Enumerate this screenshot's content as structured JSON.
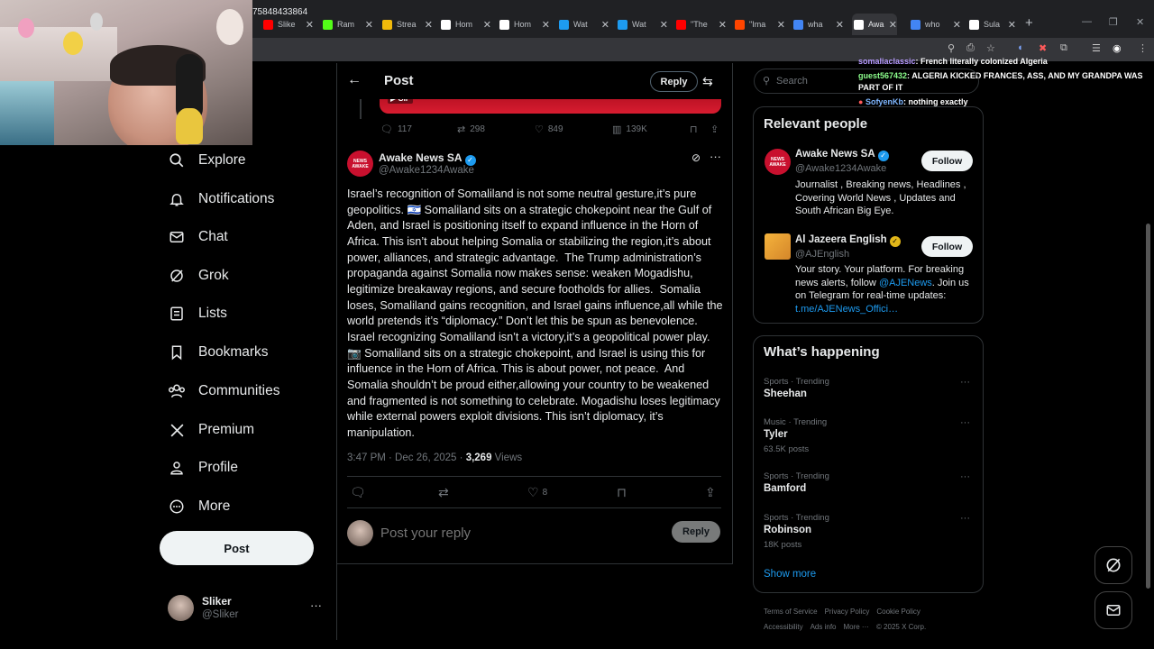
{
  "browser": {
    "tabs": [
      {
        "label": "Slike",
        "color": "#ff0000"
      },
      {
        "label": "Ram",
        "color": "#53fc18"
      },
      {
        "label": "Strea",
        "color": "#f0b90b"
      },
      {
        "label": "Hom",
        "color": "#ffffff"
      },
      {
        "label": "Hom",
        "color": "#ffffff"
      },
      {
        "label": "Wat",
        "color": "#1d9bf0"
      },
      {
        "label": "Wat",
        "color": "#1d9bf0"
      },
      {
        "label": "\"The",
        "color": "#ff0000"
      },
      {
        "label": "\"Ima",
        "color": "#ff4500"
      },
      {
        "label": "wha",
        "color": "#4285f4"
      },
      {
        "label": "Awa",
        "color": "#ffffff"
      },
      {
        "label": "who",
        "color": "#4285f4"
      },
      {
        "label": "Sula",
        "color": "#ffffff"
      }
    ],
    "active_tab": 10,
    "url": "75848433864"
  },
  "chat": [
    {
      "user": "somaliaclassic",
      "text": ": French literally colonized Algeria",
      "userColor": "#b79bff"
    },
    {
      "user": "guest567432",
      "text": ": ALGERIA KICKED FRANCES, ASS, AND MY GRANDPA WAS PART OF IT",
      "userColor": "#8dff8d"
    },
    {
      "user": "SofyenKb",
      "text": ": nothing exactly",
      "userColor": "#7fb6ff"
    }
  ],
  "nav": {
    "items": [
      "Explore",
      "Notifications",
      "Chat",
      "Grok",
      "Lists",
      "Bookmarks",
      "Communities",
      "Premium",
      "Profile",
      "More"
    ],
    "post_label": "Post",
    "user_name": "Sliker",
    "user_handle": "@Sliker"
  },
  "main": {
    "title": "Post",
    "reply_label": "Reply",
    "gif_label": "GIF",
    "quoted_stats": {
      "replies": "117",
      "reposts": "298",
      "likes": "849",
      "views": "139K"
    },
    "author": {
      "name": "Awake News SA",
      "handle": "@Awake1234Awake",
      "avatar_text": "NEWS AWAKE"
    },
    "text": "Israel’s recognition of Somaliland is not some neutral gesture,it’s pure geopolitics. 🇮🇱 Somaliland sits on a strategic chokepoint near the Gulf of Aden, and Israel is positioning itself to expand influence in the Horn of Africa. This isn’t about helping Somalia or stabilizing the region,it’s about power, alliances, and strategic advantage.  The Trump administration’s propaganda against Somalia now makes sense: weaken Mogadishu, legitimize breakaway regions, and secure footholds for allies.  Somalia loses, Somaliland gains recognition, and Israel gains influence,all while the world pretends it’s “diplomacy.” Don’t let this be spun as benevolence. Israel recognizing Somaliland isn’t a victory,it’s a geopolitical power play. 📷 Somaliland sits on a strategic chokepoint, and Israel is using this for influence in the Horn of Africa. This is about power, not peace.  And Somalia shouldn’t be proud either,allowing your country to be weakened and fragmented is not something to celebrate. Mogadishu loses legitimacy while external powers exploit divisions. This isn’t diplomacy, it’s manipulation.",
    "time": "3:47 PM · Dec 26, 2025 · ",
    "views_count": "3,269",
    "views_label": " Views",
    "likes": "8",
    "reply_placeholder": "Post your reply",
    "reply_button": "Reply"
  },
  "right": {
    "search_placeholder": "Search",
    "relevant_title": "Relevant people",
    "people": [
      {
        "name": "Awake News SA",
        "handle": "@Awake1234Awake",
        "bio": "Journalist , Breaking news, Headlines , Covering World News , Updates and South African Big Eye.",
        "follow": "Follow"
      },
      {
        "name": "Al Jazeera English",
        "handle": "@AJEnglish",
        "bio_pre": "Your story. Your platform. For breaking news alerts, follow ",
        "bio_link1": "@AJENews",
        "bio_mid": ". Join us on Telegram for real-time updates: ",
        "bio_link2": "t.me/AJENews_Offici…",
        "follow": "Follow"
      }
    ],
    "happening_title": "What’s happening",
    "trends": [
      {
        "cat": "Sports · Trending",
        "name": "Sheehan",
        "count": ""
      },
      {
        "cat": "Music · Trending",
        "name": "Tyler",
        "count": "63.5K posts"
      },
      {
        "cat": "Sports · Trending",
        "name": "Bamford",
        "count": ""
      },
      {
        "cat": "Sports · Trending",
        "name": "Robinson",
        "count": "18K posts"
      }
    ],
    "show_more": "Show more",
    "footer_row1": [
      "Terms of Service",
      "Privacy Policy",
      "Cookie Policy"
    ],
    "footer_row2": [
      "Accessibility",
      "Ads info",
      "More ···",
      "© 2025 X Corp."
    ]
  }
}
